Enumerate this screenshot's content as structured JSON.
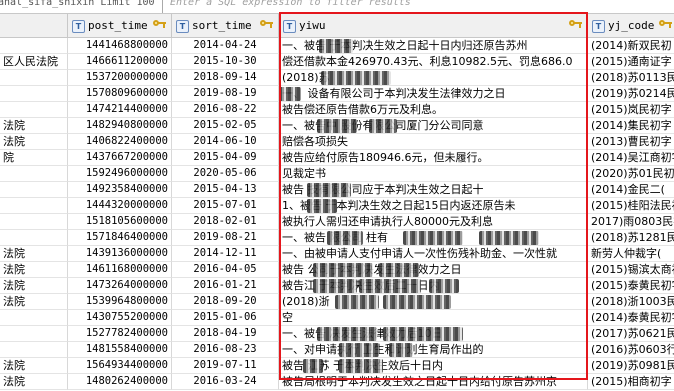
{
  "toolbar": {
    "query_text": "anal_sifa_shixin Limit 100",
    "filter_placeholder": "Enter a SQL expression to filter results"
  },
  "columns": [
    {
      "label": "",
      "type_icon": ""
    },
    {
      "label": "post_time",
      "type_icon": "T"
    },
    {
      "label": "sort_time",
      "type_icon": "T"
    },
    {
      "label": "yiwu",
      "type_icon": "T"
    },
    {
      "label": "yj_code",
      "type_icon": "T"
    }
  ],
  "rows": [
    {
      "court": "",
      "post_time": "1441468800000",
      "sort_time": "2014-04-24",
      "yiwu": "一、被告 于本判决生效之日起十日内归还原告苏州",
      "yj_code": "(2014)新双民初"
    },
    {
      "court": "区人民法院",
      "post_time": "1466611200000",
      "sort_time": "2015-10-30",
      "yiwu": "偿还借款本金426970.43元、利息10982.5元、罚息686.0",
      "yj_code": "(2015)通南证字"
    },
    {
      "court": "",
      "post_time": "1537200000000",
      "sort_time": "2018-09-14",
      "yiwu": "(2018)苏",
      "yj_code": "(2018)苏0113民初"
    },
    {
      "court": "",
      "post_time": "1570809600000",
      "sort_time": "2019-08-19",
      "yiwu": "一、 设备有限公司于本判决发生法律效力之日",
      "yj_code": "(2019)苏0214民初"
    },
    {
      "court": "",
      "post_time": "1474214400000",
      "sort_time": "2016-08-22",
      "yiwu": "被告偿还原告借款6万元及利息。",
      "yj_code": "(2015)岚民初字"
    },
    {
      "court": "法院",
      "post_time": "1482940800000",
      "sort_time": "2015-02-05",
      "yiwu": "一、被告中 股份有限公司厦门分公司同意",
      "yj_code": "(2014)集民初字"
    },
    {
      "court": "法院",
      "post_time": "1406822400000",
      "sort_time": "2014-06-10",
      "yiwu": "赔偿各项损失",
      "yj_code": "(2013)曹民初字"
    },
    {
      "court": "院",
      "post_time": "1437667200000",
      "sort_time": "2015-04-09",
      "yiwu": "被告应给付原告180946.6元，但未履行。",
      "yj_code": "(2014)吴江商初字"
    },
    {
      "court": "",
      "post_time": "1592496000000",
      "sort_time": "2020-05-06",
      "yiwu": "见裁定书",
      "yj_code": "(2020)苏01民初"
    },
    {
      "court": "",
      "post_time": "1492358400000",
      "sort_time": "2015-04-13",
      "yiwu": "被告 技有限公司应于本判决生效之日起十",
      "yj_code": "(2014)金民二("
    },
    {
      "court": "",
      "post_time": "1444320000000",
      "sort_time": "2015-07-01",
      "yiwu": "1、被告 于本判决生效之日起15日内返还原告未",
      "yj_code": "(2015)桂阳法民初"
    },
    {
      "court": "",
      "post_time": "1518105600000",
      "sort_time": "2018-02-01",
      "yiwu": "被执行人需归还申请执行人80000元及利息",
      "yj_code": "2017)雨0803民初"
    },
    {
      "court": "",
      "post_time": "1571846400000",
      "sort_time": "2019-08-21",
      "yiwu": "一、被告 限公司 柱有",
      "yj_code": "(2018)苏1281民初"
    },
    {
      "court": "法院",
      "post_time": "1439136000000",
      "sort_time": "2014-12-11",
      "yiwu": "一、由被申请人支付申请人一次性伤残补助金、一次性就",
      "yj_code": "新劳人仲裁字("
    },
    {
      "court": "法院",
      "post_time": "1461168000000",
      "sort_time": "2016-04-05",
      "yiwu": "被告 公司于本判决发生法律效力之日",
      "yj_code": "(2015)锡滨太商初"
    },
    {
      "court": "法院",
      "post_time": "1473264000000",
      "sort_time": "2016-01-21",
      "yiwu": "被告江 于本判决生效后二十日内",
      "yj_code": "(2015)泰黄民初字"
    },
    {
      "court": "法院",
      "post_time": "1539964800000",
      "sort_time": "2018-09-20",
      "yiwu": "(2018)浙",
      "yj_code": "(2018)浙1003民"
    },
    {
      "court": "",
      "post_time": "1430755200000",
      "sort_time": "2015-01-06",
      "yiwu": "空",
      "yj_code": "(2014)泰黄民初字"
    },
    {
      "court": "",
      "post_time": "1527782400000",
      "sort_time": "2018-04-19",
      "yiwu": "一、被告 决发生法律效力后10日",
      "yj_code": "(2017)苏0621民初"
    },
    {
      "court": "",
      "post_time": "1481558400000",
      "sort_time": "2016-08-23",
      "yiwu": "一、对申请执行 卫生和计划生育局作出的",
      "yj_code": "(2016)苏0603行审"
    },
    {
      "court": "法院",
      "post_time": "1564934400000",
      "sort_time": "2019-07-11",
      "yiwu": "被告 江苏 于本判决生效后十日内",
      "yj_code": "(2019)苏0981民初"
    },
    {
      "court": "法院",
      "post_time": "1480262400000",
      "sort_time": "2016-03-24",
      "yiwu": "被告局根明于本判决发生效之日起十日内给付原告苏州京",
      "yj_code": "(2015)相商初字"
    }
  ]
}
